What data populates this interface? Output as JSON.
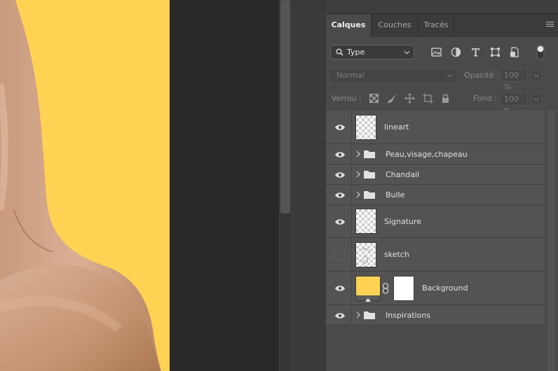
{
  "panel": {
    "tabs": [
      {
        "label": "Calques",
        "active": true
      },
      {
        "label": "Couches",
        "active": false
      },
      {
        "label": "Tracés",
        "active": false
      }
    ],
    "filter": {
      "label": "Type"
    },
    "blend_mode": "Normal",
    "opacity_label": "Opacité :",
    "opacity_value": "100 %",
    "lock_label": "Verrou :",
    "fill_label": "Fond :",
    "fill_value": "100 %"
  },
  "layers": [
    {
      "name": "lineart",
      "type": "layer",
      "visible": true
    },
    {
      "name": "Peau,visage,chapeau",
      "type": "group",
      "visible": true
    },
    {
      "name": "Chandail",
      "type": "group",
      "visible": true
    },
    {
      "name": "Bulle",
      "type": "group",
      "visible": true
    },
    {
      "name": "Signature",
      "type": "layer",
      "visible": true
    },
    {
      "name": "sketch",
      "type": "layer",
      "visible": false
    },
    {
      "name": "Background",
      "type": "layer-with-mask",
      "visible": true
    },
    {
      "name": "Inspirations",
      "type": "group",
      "visible": true
    }
  ],
  "colors": {
    "canvas_yellow": "#fed353",
    "skin": "#d7aa8a",
    "panel_bg": "#4a4a4a",
    "layer_row": "#535353"
  }
}
